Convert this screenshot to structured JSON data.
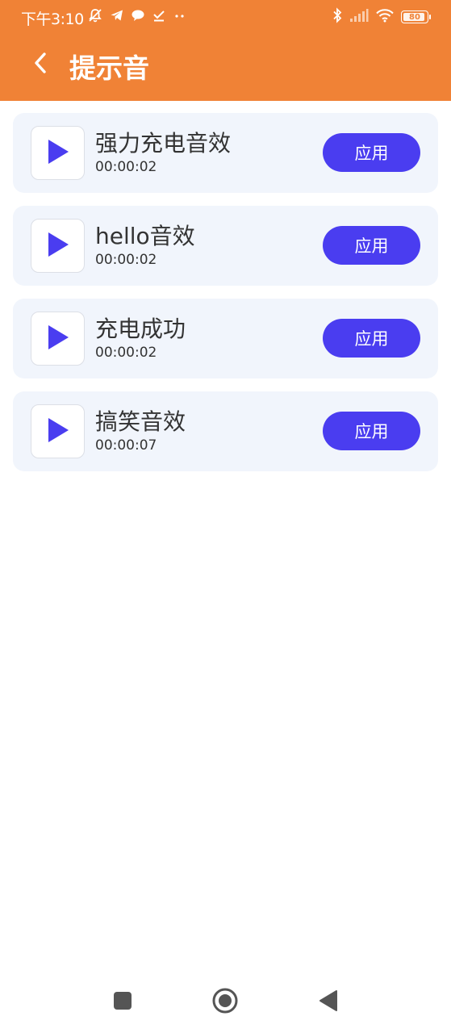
{
  "status_bar": {
    "time": "下午3:10",
    "battery": "80",
    "left_icons": [
      "mute-bell-icon",
      "telegram-icon",
      "chat-bubble-icon",
      "check-download-icon",
      "more-dots-icon"
    ],
    "right_icons": [
      "bluetooth-icon",
      "signal-icon",
      "wifi-icon",
      "battery-icon"
    ]
  },
  "header": {
    "title": "提示音",
    "back_icon": "chevron-left-icon",
    "background": "#f08236"
  },
  "sounds": [
    {
      "name": "强力充电音效",
      "duration": "00:00:02",
      "action": "应用"
    },
    {
      "name": "hello音效",
      "duration": "00:00:02",
      "action": "应用"
    },
    {
      "name": "充电成功",
      "duration": "00:00:02",
      "action": "应用"
    },
    {
      "name": "搞笑音效",
      "duration": "00:00:07",
      "action": "应用"
    }
  ],
  "colors": {
    "accent": "#4a3df0",
    "card_background": "#f1f5fc",
    "header": "#f08236"
  },
  "nav_bar": {
    "icons": [
      "recent-apps-icon",
      "home-icon",
      "back-triangle-icon"
    ]
  }
}
